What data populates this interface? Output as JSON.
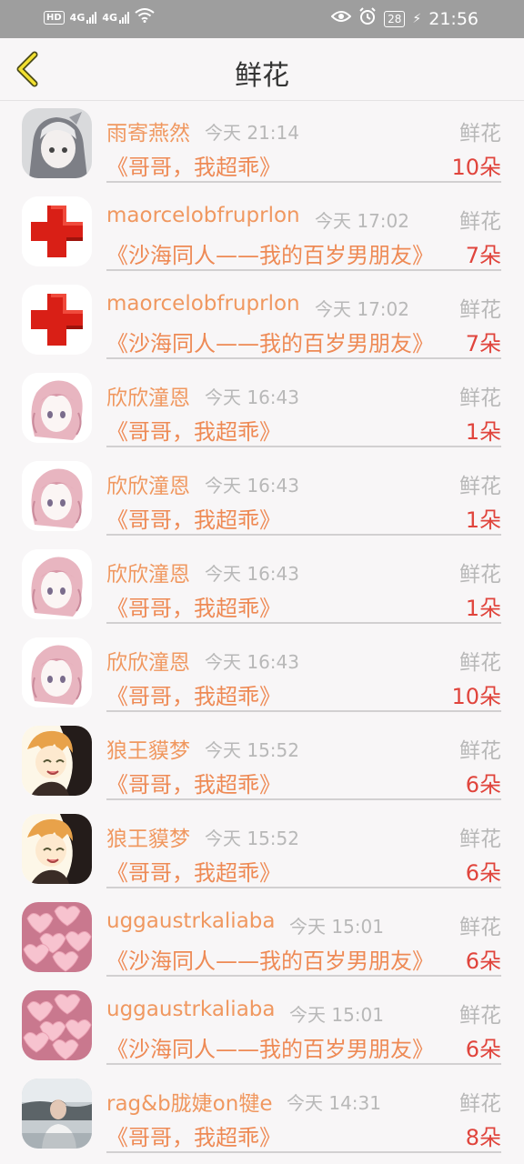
{
  "status_bar": {
    "hd": "HD",
    "net1": "4G",
    "net2": "4G",
    "battery": "28",
    "time": "21:56"
  },
  "header": {
    "title": "鲜花"
  },
  "colors": {
    "name": "#f09860",
    "book": "#ee8a55",
    "count": "#e0443c",
    "muted": "#b8b8b8"
  },
  "items": [
    {
      "avatar": "anime-girl-gray",
      "name": "雨寄燕然",
      "time": "今天 21:14",
      "kind": "鲜花",
      "book": "《哥哥，我超乖》",
      "count": "10朵"
    },
    {
      "avatar": "red-cross",
      "name": "maorcelobfruprlon",
      "time": "今天 17:02",
      "kind": "鲜花",
      "book": "《沙海同人——我的百岁男朋友》",
      "count": "7朵"
    },
    {
      "avatar": "red-cross",
      "name": "maorcelobfruprlon",
      "time": "今天 17:02",
      "kind": "鲜花",
      "book": "《沙海同人——我的百岁男朋友》",
      "count": "7朵"
    },
    {
      "avatar": "pink-hair-girl",
      "name": "欣欣潼恩",
      "time": "今天 16:43",
      "kind": "鲜花",
      "book": "《哥哥，我超乖》",
      "count": "1朵"
    },
    {
      "avatar": "pink-hair-girl",
      "name": "欣欣潼恩",
      "time": "今天 16:43",
      "kind": "鲜花",
      "book": "《哥哥，我超乖》",
      "count": "1朵"
    },
    {
      "avatar": "pink-hair-girl",
      "name": "欣欣潼恩",
      "time": "今天 16:43",
      "kind": "鲜花",
      "book": "《哥哥，我超乖》",
      "count": "1朵"
    },
    {
      "avatar": "pink-hair-girl",
      "name": "欣欣潼恩",
      "time": "今天 16:43",
      "kind": "鲜花",
      "book": "《哥哥，我超乖》",
      "count": "10朵"
    },
    {
      "avatar": "anime-boy-orange",
      "name": "狼王貘梦",
      "time": "今天 15:52",
      "kind": "鲜花",
      "book": "《哥哥，我超乖》",
      "count": "6朵"
    },
    {
      "avatar": "anime-boy-orange",
      "name": "狼王貘梦",
      "time": "今天 15:52",
      "kind": "鲜花",
      "book": "《哥哥，我超乖》",
      "count": "6朵"
    },
    {
      "avatar": "pink-hearts",
      "name": "uggaustrkaliaba",
      "time": "今天 15:01",
      "kind": "鲜花",
      "book": "《沙海同人——我的百岁男朋友》",
      "count": "6朵"
    },
    {
      "avatar": "pink-hearts",
      "name": "uggaustrkaliaba",
      "time": "今天 15:01",
      "kind": "鲜花",
      "book": "《沙海同人——我的百岁男朋友》",
      "count": "6朵"
    },
    {
      "avatar": "man-photo",
      "name": "rag&b胧婕on犍e",
      "time": "今天 14:31",
      "kind": "鲜花",
      "book": "《哥哥，我超乖》",
      "count": "8朵"
    }
  ]
}
